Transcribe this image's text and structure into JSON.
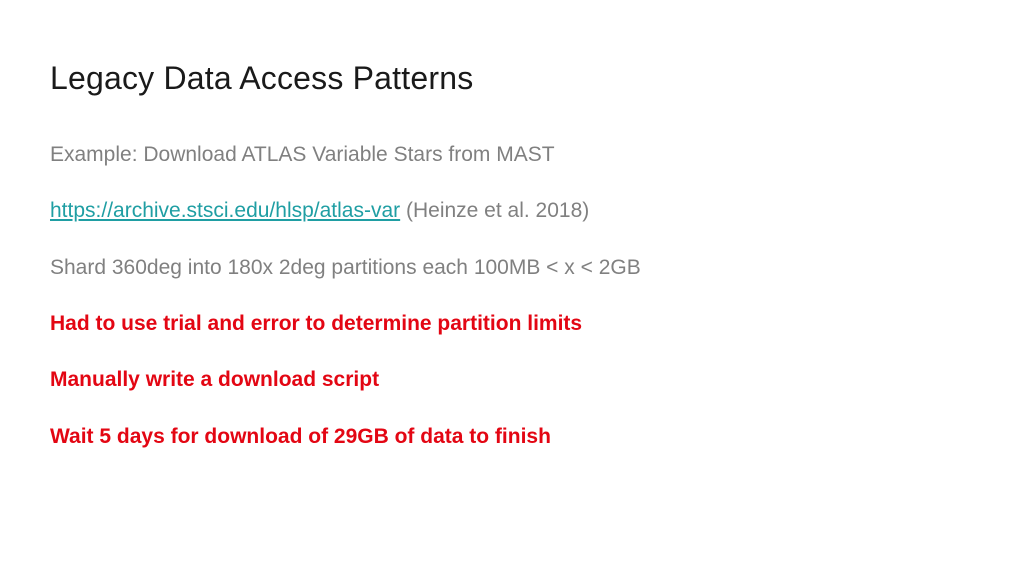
{
  "title": "Legacy Data Access Patterns",
  "lines": {
    "example": "Example: Download ATLAS Variable Stars from MAST",
    "link_text": "https://archive.stsci.edu/hlsp/atlas-var",
    "link_citation": " (Heinze et al. 2018)",
    "shard": "Shard 360deg into 180x 2deg partitions each 100MB < x < 2GB",
    "trial": "Had to use trial and error to determine partition limits",
    "script": "Manually write a download script",
    "wait": "Wait 5 days for download of 29GB of data to finish"
  }
}
